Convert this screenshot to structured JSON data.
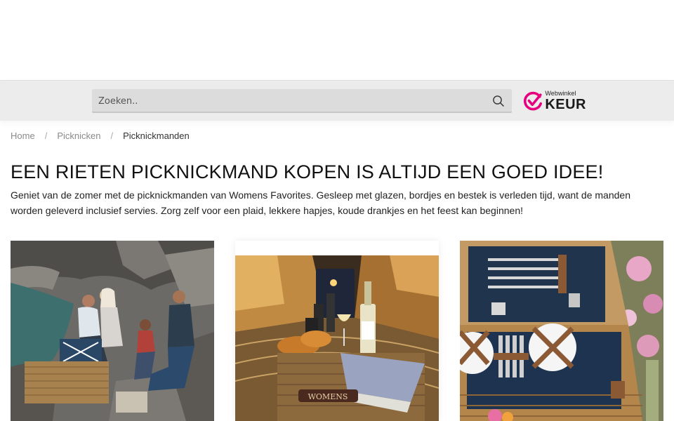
{
  "search": {
    "placeholder": "Zoeken..",
    "icon": "search-icon"
  },
  "trust_badge": {
    "small_text": "Webwinkel",
    "big_text": "KEUR",
    "accent_color": "#e6007e"
  },
  "breadcrumb": {
    "items": [
      "Home",
      "Picknicken"
    ],
    "separator": "/",
    "current": "Picknickmanden"
  },
  "page": {
    "title": "EEN RIETEN PICKNICKMAND KOPEN IS ALTIJD EEN GOED IDEE!",
    "intro": "Geniet van de zomer met de picknickmanden van Womens Favorites. Gesleep met glazen, bordjes en bestek is verleden tijd, want de manden worden geleverd inclusief servies. Zorg zelf voor een plaid, lekkere hapjes, koude drankjes en het feest kan beginnen!"
  },
  "products": [
    {
      "image": "picnic-rocks-photo"
    },
    {
      "image": "picnic-street-photo",
      "logo_text": "WOMENS"
    },
    {
      "image": "picnic-basket-open-photo"
    }
  ]
}
